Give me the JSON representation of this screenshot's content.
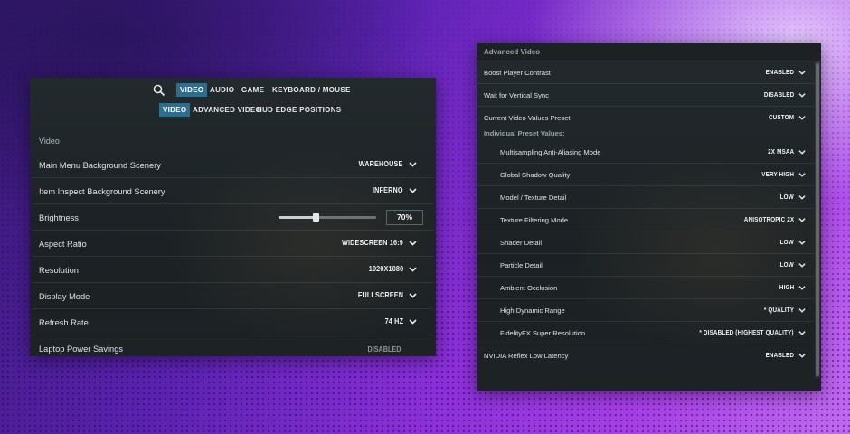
{
  "left_panel": {
    "tabs": [
      "VIDEO",
      "AUDIO",
      "GAME",
      "KEYBOARD / MOUSE"
    ],
    "active_tab": "VIDEO",
    "subtabs": [
      "VIDEO",
      "ADVANCED VIDEO",
      "HUD EDGE POSITIONS"
    ],
    "active_subtab": "VIDEO",
    "section_title": "Video",
    "rows": [
      {
        "label": "Main Menu Background Scenery",
        "value": "WAREHOUSE"
      },
      {
        "label": "Item Inspect Background Scenery",
        "value": "INFERNO"
      },
      {
        "label": "Brightness",
        "value": "70%",
        "slider_fraction": 0.38
      },
      {
        "label": "Aspect Ratio",
        "value": "WIDESCREEN 16:9"
      },
      {
        "label": "Resolution",
        "value": "1920X1080"
      },
      {
        "label": "Display Mode",
        "value": "FULLSCREEN"
      },
      {
        "label": "Refresh Rate",
        "value": "74 HZ"
      },
      {
        "label": "Laptop Power Savings",
        "value": "DISABLED",
        "disabled": true
      }
    ]
  },
  "right_panel": {
    "title": "Advanced Video",
    "top_rows": [
      {
        "label": "Boost Player Contrast",
        "value": "ENABLED"
      },
      {
        "label": "Wait for Vertical Sync",
        "value": "DISABLED"
      },
      {
        "label": "Current Video Values Preset:",
        "value": "CUSTOM"
      }
    ],
    "preset_header": "Individual Preset Values:",
    "preset_rows": [
      {
        "label": "Multisampling Anti-Aliasing Mode",
        "value": "2X MSAA"
      },
      {
        "label": "Global Shadow Quality",
        "value": "VERY HIGH"
      },
      {
        "label": "Model / Texture Detail",
        "value": "LOW"
      },
      {
        "label": "Texture Filtering Mode",
        "value": "ANISOTROPIC 2X"
      },
      {
        "label": "Shader Detail",
        "value": "LOW"
      },
      {
        "label": "Particle Detail",
        "value": "LOW"
      },
      {
        "label": "Ambient Occlusion",
        "value": "HIGH"
      },
      {
        "label": "High Dynamic Range",
        "value": "* QUALITY"
      },
      {
        "label": "FidelityFX Super Resolution",
        "value": "* DISABLED (HIGHEST QUALITY)"
      }
    ],
    "bottom_rows": [
      {
        "label": "NVIDIA Reflex Low Latency",
        "value": "ENABLED"
      }
    ]
  },
  "icons": {
    "search": "search-icon",
    "chevron": "chevron-down-icon"
  },
  "colors": {
    "active_tab": "#2f6d8c",
    "panel_bg": "#1d2326"
  }
}
